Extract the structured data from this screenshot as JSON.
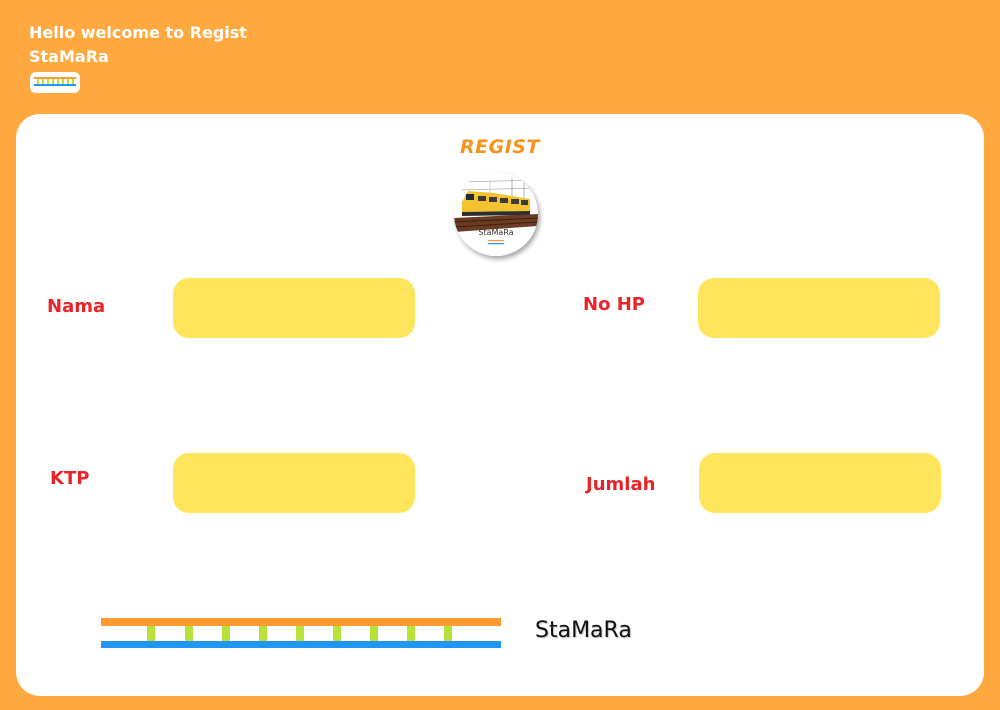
{
  "header": {
    "greeting": "Hello welcome to Regist",
    "brand": "StaMaRa"
  },
  "form": {
    "title": "REGIST",
    "logo_text": "StaMaRa",
    "fields": {
      "nama": {
        "label": "Nama",
        "value": ""
      },
      "no_hp": {
        "label": "No HP",
        "value": ""
      },
      "ktp": {
        "label": "KTP",
        "value": ""
      },
      "jumlah": {
        "label": "Jumlah",
        "value": ""
      }
    }
  },
  "footer": {
    "brand": "StaMaRa"
  },
  "colors": {
    "background": "#ffa940",
    "card": "#ffffff",
    "title": "#f7941d",
    "label": "#e8242a",
    "input": "#fee55c",
    "rail_top": "#ff9a2e",
    "rail_bottom": "#2196f3",
    "sleeper": "#b6e23a"
  },
  "icons": {
    "header_badge": "rail-track-icon",
    "logo": "train-logo-icon",
    "footer": "rail-track-icon"
  }
}
